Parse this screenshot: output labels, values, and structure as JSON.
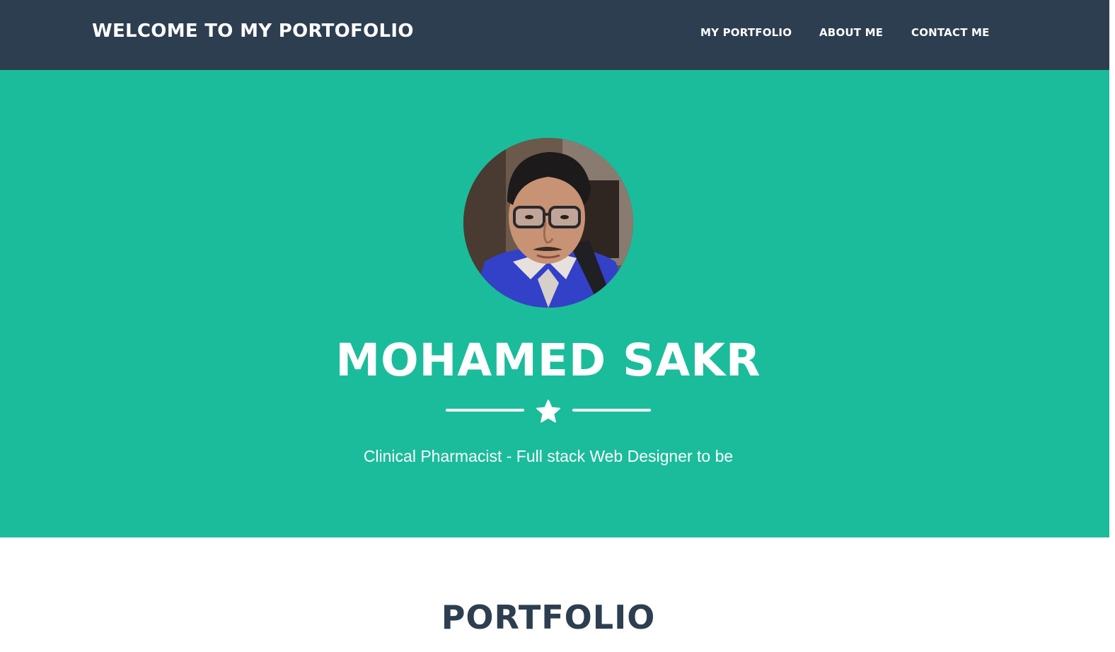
{
  "navbar": {
    "brand": "WELCOME TO MY PORTOFOLIO",
    "links": [
      {
        "label": "MY PORTFOLIO"
      },
      {
        "label": "ABOUT ME"
      },
      {
        "label": "CONTACT ME"
      }
    ],
    "bg_color": "#2c3e50"
  },
  "masthead": {
    "bg_color": "#1abc9c",
    "name": "MOHAMED SAKR",
    "divider_icon": "star-icon",
    "subtitle": "Clinical Pharmacist - Full stack Web Designer to be"
  },
  "portfolio": {
    "title": "PORTFOLIO"
  }
}
